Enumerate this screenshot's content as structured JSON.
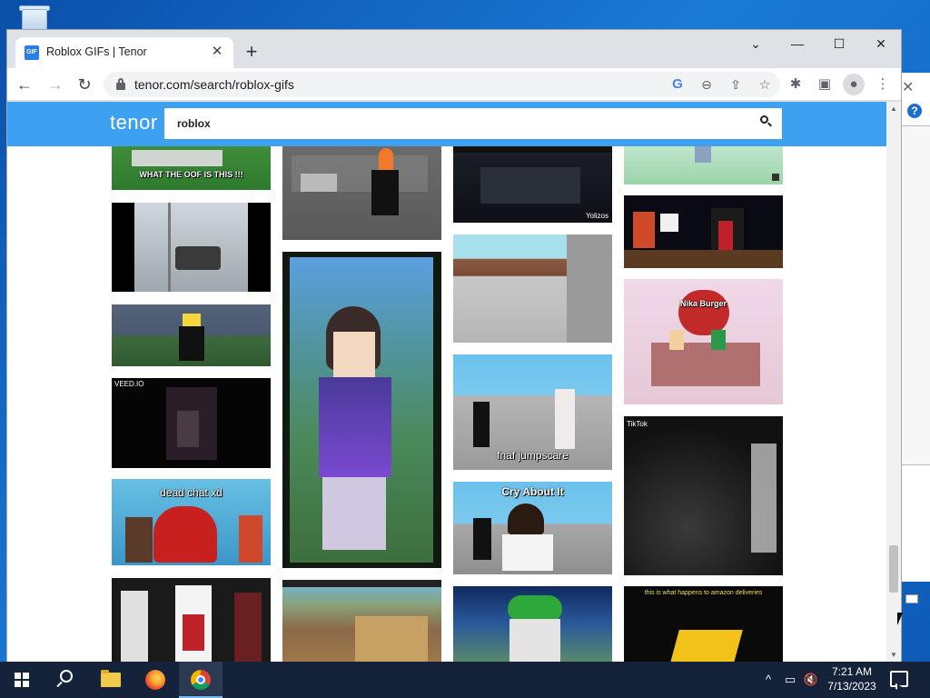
{
  "browser": {
    "tab_title": "Roblox GIFs | Tenor",
    "tab_favicon": "GIF",
    "url": "tenor.com/search/roblox-gifs",
    "new_tab": "+",
    "close_glyph": "✕",
    "controls": {
      "dropdown": "⌄",
      "minimize": "—",
      "maximize": "☐",
      "close": "✕"
    }
  },
  "tenor": {
    "logo": "tenor",
    "search_value": "roblox"
  },
  "gif_captions": {
    "oof": "WHAT THE OOF IS THIS !!!",
    "veed": "VEED.IO",
    "dead_chat": "dead chat xd",
    "yolizos": "Yolizos",
    "fnaf": "fnaf jumpscare",
    "cry": "Cry About It",
    "tiktok": "TikTok",
    "nika": "Nika Burger",
    "deliveries": "this is what happens to amazon deliveries"
  },
  "taskbar": {
    "time": "7:21 AM",
    "date": "7/13/2023",
    "tray_chevron": "^"
  },
  "icons": [
    "windows-logo-icon",
    "search-icon",
    "file-explorer-icon",
    "firefox-icon",
    "chrome-icon",
    "network-icon",
    "volume-muted-icon",
    "notification-icon",
    "recycle-bin-icon"
  ]
}
